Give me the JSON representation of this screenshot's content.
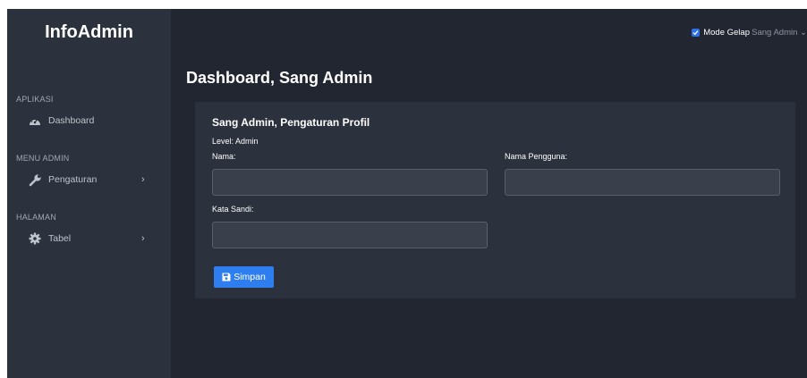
{
  "app": {
    "brand": "InfoAdmin"
  },
  "topbar": {
    "dark_mode_label": "Mode Gelap",
    "dark_mode_checked": true,
    "user_name": "Sang Admin"
  },
  "sidebar": {
    "sections": [
      {
        "heading": "APLIKASI",
        "items": [
          {
            "label": "Dashboard",
            "icon": "tachometer-icon",
            "has_submenu": false
          }
        ]
      },
      {
        "heading": "MENU ADMIN",
        "items": [
          {
            "label": "Pengaturan",
            "icon": "wrench-icon",
            "has_submenu": true,
            "chevron": "›"
          }
        ]
      },
      {
        "heading": "HALAMAN",
        "items": [
          {
            "label": "Tabel",
            "icon": "gear-icon",
            "has_submenu": true,
            "chevron": "›"
          }
        ]
      }
    ]
  },
  "main": {
    "page_title": "Dashboard, Sang Admin",
    "profile_card": {
      "title": "Sang Admin, Pengaturan Profil",
      "level_text": "Level: Admin",
      "fields": {
        "name": {
          "label": "Nama:",
          "value": ""
        },
        "username": {
          "label": "Nama Pengguna:",
          "value": ""
        },
        "password": {
          "label": "Kata Sandi:",
          "value": ""
        }
      },
      "save_label": "Simpan"
    }
  },
  "colors": {
    "background": "#212631",
    "sidebar": "#2b313d",
    "card": "#2b313d",
    "input": "#3a404b",
    "accent": "#2f7ef0"
  }
}
